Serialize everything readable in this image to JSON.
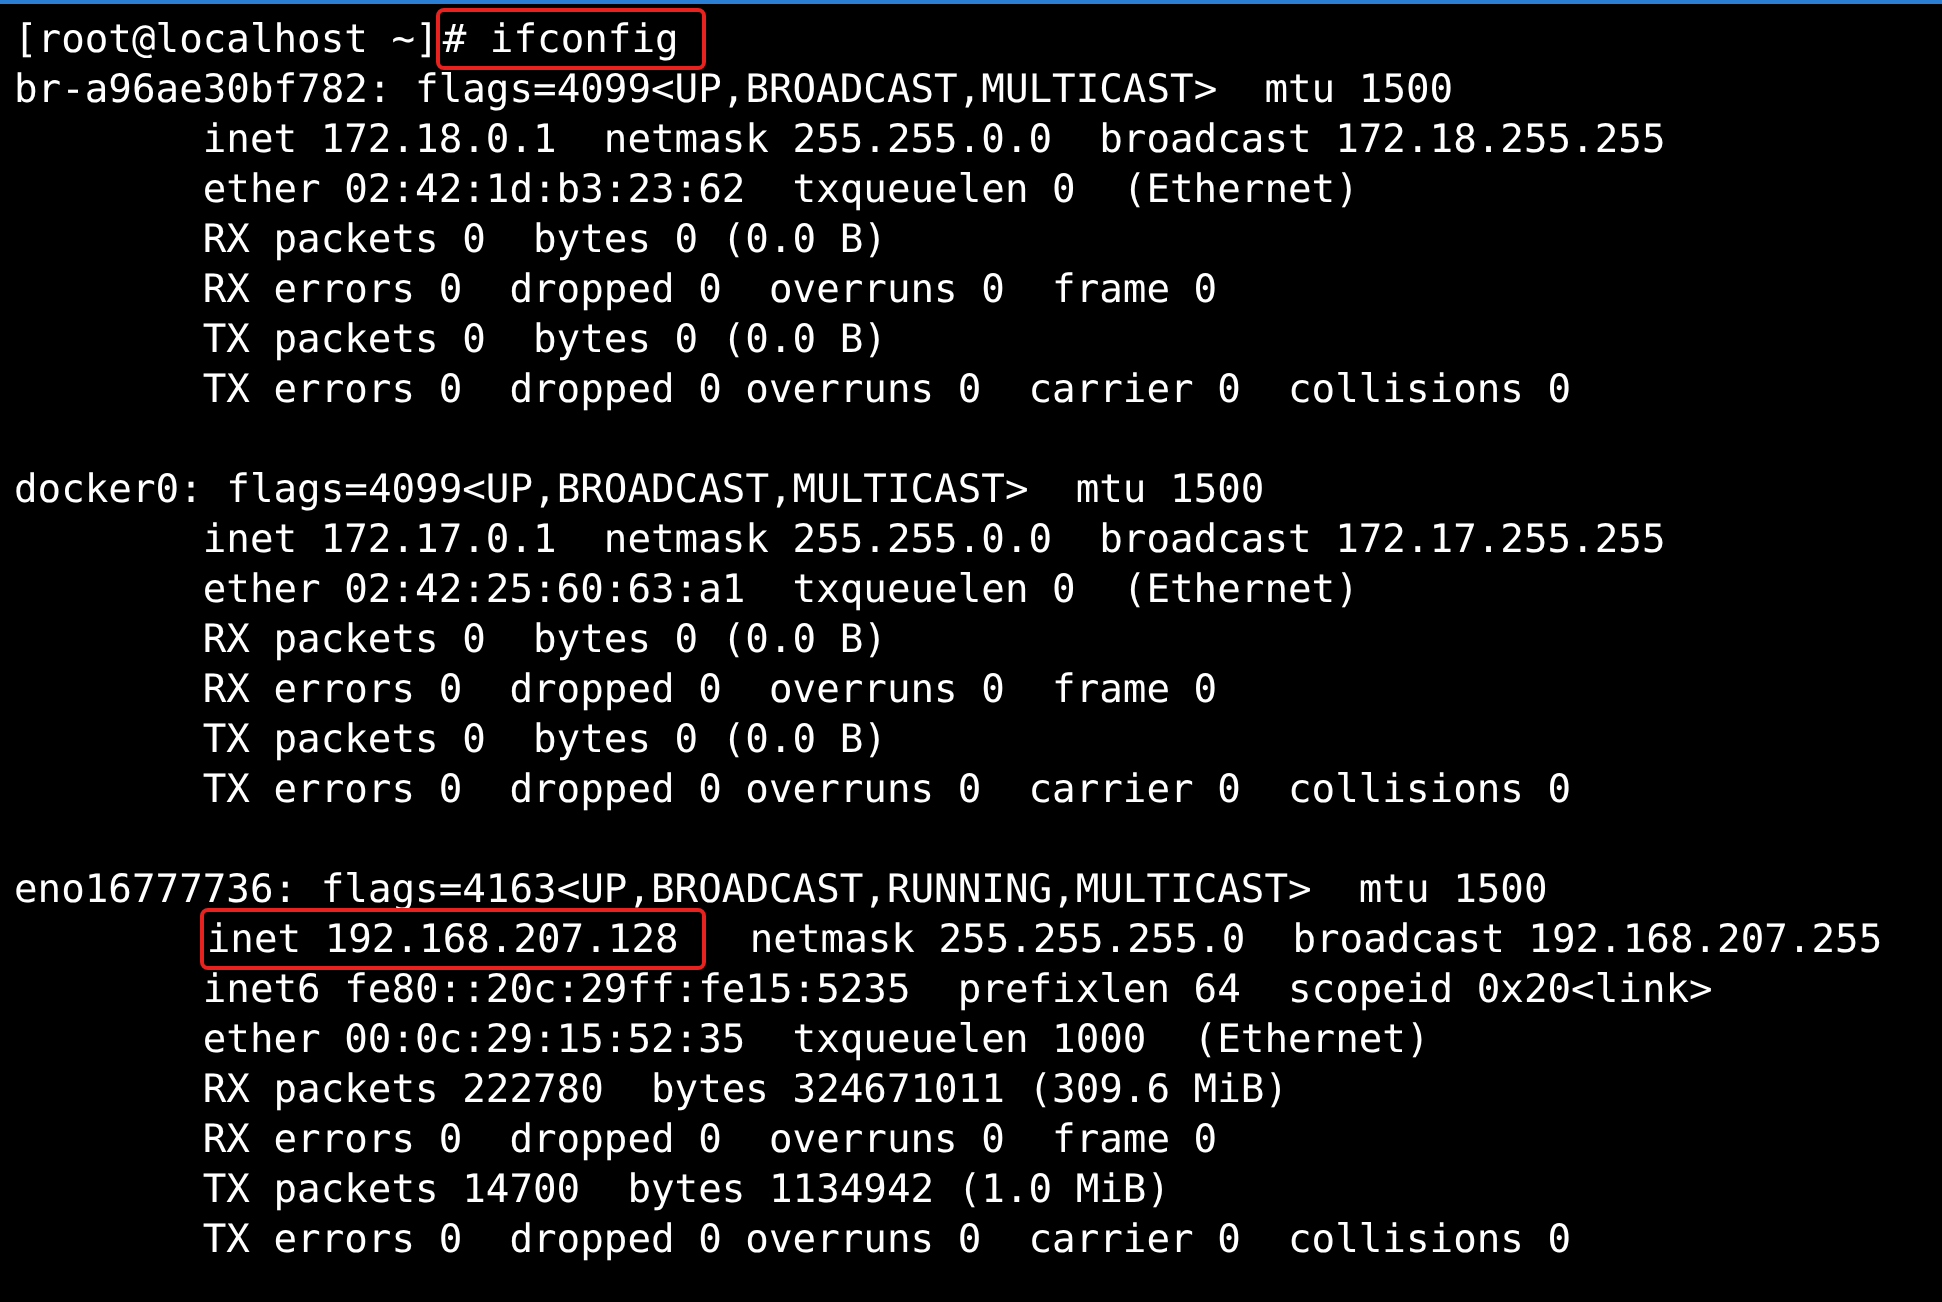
{
  "terminal": {
    "lines": [
      {
        "kind": "text",
        "indented": false,
        "segments": [
          {
            "text": "[root@localhost ~]",
            "highlighted": false
          },
          {
            "text": "# ifconfig",
            "highlighted": true
          }
        ]
      },
      {
        "kind": "text",
        "indented": false,
        "segments": [
          {
            "text": "br-a96ae30bf782: flags=4099<UP,BROADCAST,MULTICAST>  mtu 1500",
            "highlighted": false
          }
        ]
      },
      {
        "kind": "text",
        "indented": true,
        "segments": [
          {
            "text": "inet 172.18.0.1  netmask 255.255.0.0  broadcast 172.18.255.255",
            "highlighted": false
          }
        ]
      },
      {
        "kind": "text",
        "indented": true,
        "segments": [
          {
            "text": "ether 02:42:1d:b3:23:62  txqueuelen 0  (Ethernet)",
            "highlighted": false
          }
        ]
      },
      {
        "kind": "text",
        "indented": true,
        "segments": [
          {
            "text": "RX packets 0  bytes 0 (0.0 B)",
            "highlighted": false
          }
        ]
      },
      {
        "kind": "text",
        "indented": true,
        "segments": [
          {
            "text": "RX errors 0  dropped 0  overruns 0  frame 0",
            "highlighted": false
          }
        ]
      },
      {
        "kind": "text",
        "indented": true,
        "segments": [
          {
            "text": "TX packets 0  bytes 0 (0.0 B)",
            "highlighted": false
          }
        ]
      },
      {
        "kind": "text",
        "indented": true,
        "segments": [
          {
            "text": "TX errors 0  dropped 0 overruns 0  carrier 0  collisions 0",
            "highlighted": false
          }
        ]
      },
      {
        "kind": "blank"
      },
      {
        "kind": "text",
        "indented": false,
        "segments": [
          {
            "text": "docker0: flags=4099<UP,BROADCAST,MULTICAST>  mtu 1500",
            "highlighted": false
          }
        ]
      },
      {
        "kind": "text",
        "indented": true,
        "segments": [
          {
            "text": "inet 172.17.0.1  netmask 255.255.0.0  broadcast 172.17.255.255",
            "highlighted": false
          }
        ]
      },
      {
        "kind": "text",
        "indented": true,
        "segments": [
          {
            "text": "ether 02:42:25:60:63:a1  txqueuelen 0  (Ethernet)",
            "highlighted": false
          }
        ]
      },
      {
        "kind": "text",
        "indented": true,
        "segments": [
          {
            "text": "RX packets 0  bytes 0 (0.0 B)",
            "highlighted": false
          }
        ]
      },
      {
        "kind": "text",
        "indented": true,
        "segments": [
          {
            "text": "RX errors 0  dropped 0  overruns 0  frame 0",
            "highlighted": false
          }
        ]
      },
      {
        "kind": "text",
        "indented": true,
        "segments": [
          {
            "text": "TX packets 0  bytes 0 (0.0 B)",
            "highlighted": false
          }
        ]
      },
      {
        "kind": "text",
        "indented": true,
        "segments": [
          {
            "text": "TX errors 0  dropped 0 overruns 0  carrier 0  collisions 0",
            "highlighted": false
          }
        ]
      },
      {
        "kind": "blank"
      },
      {
        "kind": "text",
        "indented": false,
        "segments": [
          {
            "text": "eno16777736: flags=4163<UP,BROADCAST,RUNNING,MULTICAST>  mtu 1500",
            "highlighted": false
          }
        ]
      },
      {
        "kind": "text",
        "indented": true,
        "segments": [
          {
            "text": "inet 192.168.207.128",
            "highlighted": true
          },
          {
            "text": "  netmask 255.255.255.0  broadcast 192.168.207.255",
            "highlighted": false
          }
        ]
      },
      {
        "kind": "text",
        "indented": true,
        "segments": [
          {
            "text": "inet6 fe80::20c:29ff:fe15:5235  prefixlen 64  scopeid 0x20<link>",
            "highlighted": false
          }
        ]
      },
      {
        "kind": "text",
        "indented": true,
        "segments": [
          {
            "text": "ether 00:0c:29:15:52:35  txqueuelen 1000  (Ethernet)",
            "highlighted": false
          }
        ]
      },
      {
        "kind": "text",
        "indented": true,
        "segments": [
          {
            "text": "RX packets 222780  bytes 324671011 (309.6 MiB)",
            "highlighted": false
          }
        ]
      },
      {
        "kind": "text",
        "indented": true,
        "segments": [
          {
            "text": "RX errors 0  dropped 0  overruns 0  frame 0",
            "highlighted": false
          }
        ]
      },
      {
        "kind": "text",
        "indented": true,
        "segments": [
          {
            "text": "TX packets 14700  bytes 1134942 (1.0 MiB)",
            "highlighted": false
          }
        ]
      },
      {
        "kind": "text",
        "indented": true,
        "segments": [
          {
            "text": "TX errors 0  dropped 0 overruns 0  carrier 0  collisions 0",
            "highlighted": false
          }
        ]
      }
    ]
  }
}
